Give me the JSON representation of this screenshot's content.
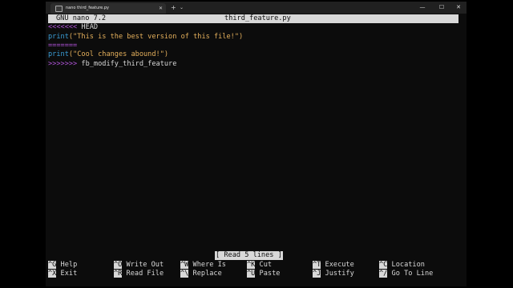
{
  "window": {
    "tab_title": "nano third_feature.py",
    "tab_close": "✕",
    "new_tab": "+",
    "dropdown": "⌄",
    "minimize": "—",
    "maximize": "☐",
    "close": "✕"
  },
  "nano": {
    "version": "GNU nano 7.2",
    "filename": "third_feature.py",
    "lines": [
      {
        "parts": [
          "<<<<<<< ",
          "HEAD"
        ]
      },
      {
        "parts": [
          "print",
          "(\"This is the best version of this file!\")"
        ]
      },
      {
        "parts": [
          "======="
        ]
      },
      {
        "parts": [
          "print",
          "(\"Cool changes abound!\")"
        ]
      },
      {
        "parts": [
          ">>>>>>> ",
          "fb_modify_third_feature"
        ]
      }
    ],
    "status": "[ Read 5 lines ]",
    "shortcuts": [
      {
        "key": "^G",
        "label": "Help"
      },
      {
        "key": "^O",
        "label": "Write Out"
      },
      {
        "key": "^W",
        "label": "Where Is"
      },
      {
        "key": "^K",
        "label": "Cut"
      },
      {
        "key": "^T",
        "label": "Execute"
      },
      {
        "key": "^C",
        "label": "Location"
      },
      {
        "key": "^X",
        "label": "Exit"
      },
      {
        "key": "^R",
        "label": "Read File"
      },
      {
        "key": "^\\",
        "label": "Replace"
      },
      {
        "key": "^U",
        "label": "Paste"
      },
      {
        "key": "^J",
        "label": "Justify"
      },
      {
        "key": "^/",
        "label": "Go To Line"
      }
    ]
  },
  "colors": {
    "conflict_marker": "#b054d8",
    "string": "#e5b05c",
    "keyword": "#3a9ed8",
    "background": "#0c0c0c",
    "header_bg": "#d8d8d8"
  }
}
